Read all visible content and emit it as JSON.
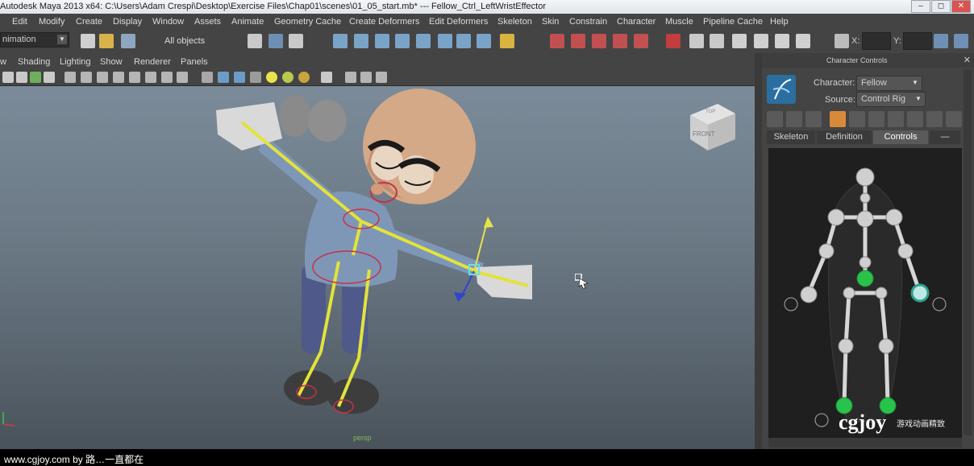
{
  "window": {
    "title": "Autodesk Maya 2013 x64: C:\\Users\\Adam Crespi\\Desktop\\Exercise Files\\Chap01\\scenes\\01_05_start.mb*   ---   Fellow_Ctrl_LeftWristEffector",
    "controls": [
      "–",
      "◻",
      "✕"
    ]
  },
  "menus": [
    "Edit",
    "Modify",
    "Create",
    "Display",
    "Window",
    "Assets",
    "Animate",
    "Geometry Cache",
    "Create Deformers",
    "Edit Deformers",
    "Skeleton",
    "Skin",
    "Constrain",
    "Character",
    "Muscle",
    "Pipeline Cache",
    "Help"
  ],
  "status_line": {
    "mode": "nimation",
    "selection_mask": "All objects",
    "x_label": "X:",
    "y_label": "Y:"
  },
  "panel_menu": [
    "Shading",
    "Lighting",
    "Show",
    "Renderer",
    "Panels"
  ],
  "viewport": {
    "camera_label": "persp",
    "viewcube_front": "FRONT",
    "viewcube_top": "TOP"
  },
  "character_controls": {
    "title": "Character Controls",
    "character_label": "Character:",
    "character_value": "Fellow",
    "source_label": "Source:",
    "source_value": "Control Rig",
    "tabs": [
      "Skeleton",
      "Definition",
      "Controls",
      "—"
    ],
    "active_tab": "Controls"
  },
  "watermark": {
    "logo": "cgjoy",
    "subtitle": "游戏动画精致"
  },
  "footer": {
    "credit": "www.cgjoy.com by 路…一直都在"
  },
  "colors": {
    "ui_bg": "#444444",
    "viewport_top": "#7b8b99",
    "viewport_bottom": "#4a535b",
    "rig_yellow": "#e3e33a",
    "hik_green": "#29c24a",
    "skin": "#d4a987",
    "shirt": "#7e97b7"
  }
}
